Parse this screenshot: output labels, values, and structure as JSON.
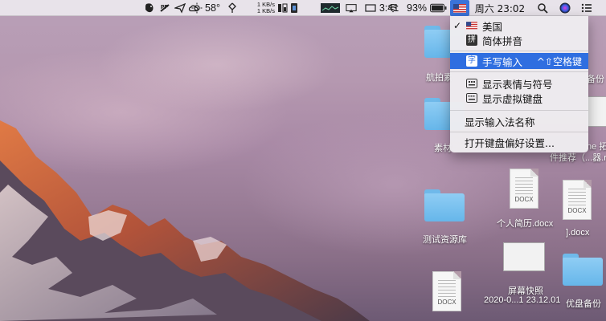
{
  "menubar": {
    "evernote_icon": "evernote-elephant-icon",
    "pf_label": "PF",
    "send_icon": "paper-plane-icon",
    "cloud_icon": "creative-cloud-icon",
    "weather_temp": "58°",
    "net_up": "1 KB/s",
    "net_down": "1 KB/s",
    "battery_percent": "93%",
    "clock_time": "3:41",
    "datetime": "周六 23:02",
    "accent": "#2f6ee0"
  },
  "input_menu": {
    "items": [
      {
        "label": "美国",
        "checked": true,
        "icon": "us-flag-icon"
      },
      {
        "label": "简体拼音",
        "checked": false,
        "icon": "pinyin-icon"
      },
      {
        "label": "手写输入",
        "shortcut": "^⇧空格键",
        "highlighted": true,
        "icon": "handwriting-icon"
      },
      {
        "label": "显示表情与符号",
        "icon": "emoji-viewer-icon"
      },
      {
        "label": "显示虚拟键盘",
        "icon": "keyboard-viewer-icon"
      },
      {
        "label": "显示输入法名称"
      },
      {
        "label": "打开键盘偏好设置..."
      }
    ]
  },
  "desktop": {
    "icons": [
      {
        "label": "航拍素"
      },
      {
        "label": "素材"
      },
      {
        "label": "测试资源库"
      },
      {
        "label": "个人简历.docx",
        "tag": "DOCX"
      },
      {
        "label": "].docx",
        "tag": "DOCX"
      },
      {
        "label": "屏幕快照",
        "label2": "2020-0...1 23.12.01"
      },
      {
        "label": "优盘备份"
      },
      {
        "label": "备份"
      },
      {
        "label": "ne 拓",
        "label2": "件推荐（...器.r"
      },
      {
        "tag": "DOCX"
      }
    ]
  }
}
